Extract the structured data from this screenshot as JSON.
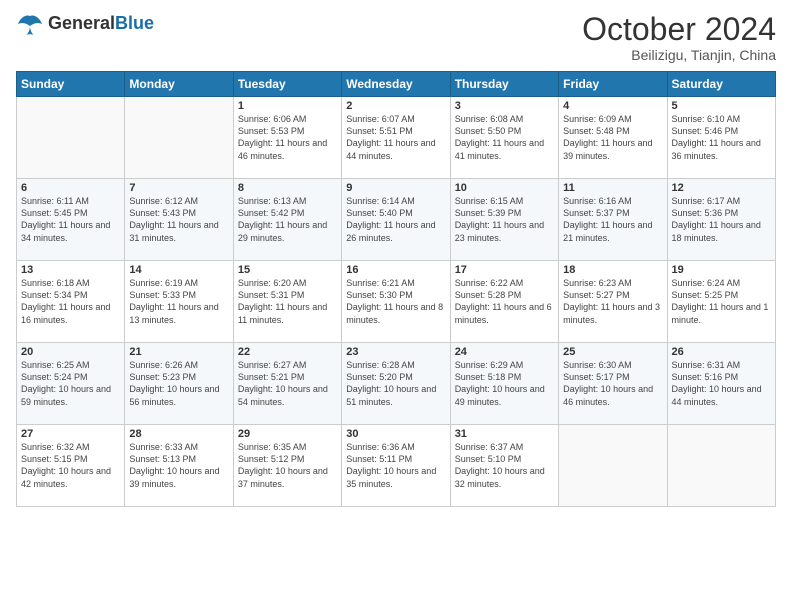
{
  "logo": {
    "text_general": "General",
    "text_blue": "Blue"
  },
  "title": "October 2024",
  "subtitle": "Beilizigu, Tianjin, China",
  "headers": [
    "Sunday",
    "Monday",
    "Tuesday",
    "Wednesday",
    "Thursday",
    "Friday",
    "Saturday"
  ],
  "weeks": [
    [
      {
        "day": "",
        "detail": ""
      },
      {
        "day": "",
        "detail": ""
      },
      {
        "day": "1",
        "detail": "Sunrise: 6:06 AM\nSunset: 5:53 PM\nDaylight: 11 hours and 46 minutes."
      },
      {
        "day": "2",
        "detail": "Sunrise: 6:07 AM\nSunset: 5:51 PM\nDaylight: 11 hours and 44 minutes."
      },
      {
        "day": "3",
        "detail": "Sunrise: 6:08 AM\nSunset: 5:50 PM\nDaylight: 11 hours and 41 minutes."
      },
      {
        "day": "4",
        "detail": "Sunrise: 6:09 AM\nSunset: 5:48 PM\nDaylight: 11 hours and 39 minutes."
      },
      {
        "day": "5",
        "detail": "Sunrise: 6:10 AM\nSunset: 5:46 PM\nDaylight: 11 hours and 36 minutes."
      }
    ],
    [
      {
        "day": "6",
        "detail": "Sunrise: 6:11 AM\nSunset: 5:45 PM\nDaylight: 11 hours and 34 minutes."
      },
      {
        "day": "7",
        "detail": "Sunrise: 6:12 AM\nSunset: 5:43 PM\nDaylight: 11 hours and 31 minutes."
      },
      {
        "day": "8",
        "detail": "Sunrise: 6:13 AM\nSunset: 5:42 PM\nDaylight: 11 hours and 29 minutes."
      },
      {
        "day": "9",
        "detail": "Sunrise: 6:14 AM\nSunset: 5:40 PM\nDaylight: 11 hours and 26 minutes."
      },
      {
        "day": "10",
        "detail": "Sunrise: 6:15 AM\nSunset: 5:39 PM\nDaylight: 11 hours and 23 minutes."
      },
      {
        "day": "11",
        "detail": "Sunrise: 6:16 AM\nSunset: 5:37 PM\nDaylight: 11 hours and 21 minutes."
      },
      {
        "day": "12",
        "detail": "Sunrise: 6:17 AM\nSunset: 5:36 PM\nDaylight: 11 hours and 18 minutes."
      }
    ],
    [
      {
        "day": "13",
        "detail": "Sunrise: 6:18 AM\nSunset: 5:34 PM\nDaylight: 11 hours and 16 minutes."
      },
      {
        "day": "14",
        "detail": "Sunrise: 6:19 AM\nSunset: 5:33 PM\nDaylight: 11 hours and 13 minutes."
      },
      {
        "day": "15",
        "detail": "Sunrise: 6:20 AM\nSunset: 5:31 PM\nDaylight: 11 hours and 11 minutes."
      },
      {
        "day": "16",
        "detail": "Sunrise: 6:21 AM\nSunset: 5:30 PM\nDaylight: 11 hours and 8 minutes."
      },
      {
        "day": "17",
        "detail": "Sunrise: 6:22 AM\nSunset: 5:28 PM\nDaylight: 11 hours and 6 minutes."
      },
      {
        "day": "18",
        "detail": "Sunrise: 6:23 AM\nSunset: 5:27 PM\nDaylight: 11 hours and 3 minutes."
      },
      {
        "day": "19",
        "detail": "Sunrise: 6:24 AM\nSunset: 5:25 PM\nDaylight: 11 hours and 1 minute."
      }
    ],
    [
      {
        "day": "20",
        "detail": "Sunrise: 6:25 AM\nSunset: 5:24 PM\nDaylight: 10 hours and 59 minutes."
      },
      {
        "day": "21",
        "detail": "Sunrise: 6:26 AM\nSunset: 5:23 PM\nDaylight: 10 hours and 56 minutes."
      },
      {
        "day": "22",
        "detail": "Sunrise: 6:27 AM\nSunset: 5:21 PM\nDaylight: 10 hours and 54 minutes."
      },
      {
        "day": "23",
        "detail": "Sunrise: 6:28 AM\nSunset: 5:20 PM\nDaylight: 10 hours and 51 minutes."
      },
      {
        "day": "24",
        "detail": "Sunrise: 6:29 AM\nSunset: 5:18 PM\nDaylight: 10 hours and 49 minutes."
      },
      {
        "day": "25",
        "detail": "Sunrise: 6:30 AM\nSunset: 5:17 PM\nDaylight: 10 hours and 46 minutes."
      },
      {
        "day": "26",
        "detail": "Sunrise: 6:31 AM\nSunset: 5:16 PM\nDaylight: 10 hours and 44 minutes."
      }
    ],
    [
      {
        "day": "27",
        "detail": "Sunrise: 6:32 AM\nSunset: 5:15 PM\nDaylight: 10 hours and 42 minutes."
      },
      {
        "day": "28",
        "detail": "Sunrise: 6:33 AM\nSunset: 5:13 PM\nDaylight: 10 hours and 39 minutes."
      },
      {
        "day": "29",
        "detail": "Sunrise: 6:35 AM\nSunset: 5:12 PM\nDaylight: 10 hours and 37 minutes."
      },
      {
        "day": "30",
        "detail": "Sunrise: 6:36 AM\nSunset: 5:11 PM\nDaylight: 10 hours and 35 minutes."
      },
      {
        "day": "31",
        "detail": "Sunrise: 6:37 AM\nSunset: 5:10 PM\nDaylight: 10 hours and 32 minutes."
      },
      {
        "day": "",
        "detail": ""
      },
      {
        "day": "",
        "detail": ""
      }
    ]
  ]
}
